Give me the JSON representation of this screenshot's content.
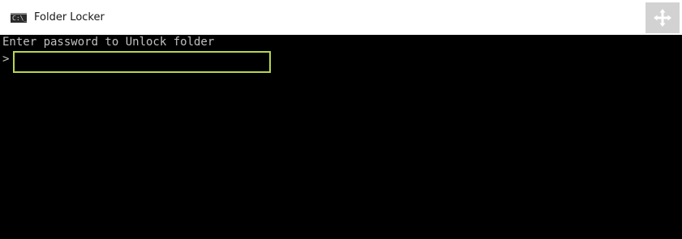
{
  "window": {
    "title": "Folder Locker",
    "icon_name": "command-prompt-icon",
    "icon_glyph": "C:\\_",
    "move_icon_name": "move-arrows-icon"
  },
  "console": {
    "message": "Enter password to Unlock folder",
    "prompt_symbol": ">",
    "password_value": "",
    "background_color": "#000000",
    "text_color": "#c0c0c0",
    "input_highlight_color": "#b8d64a"
  }
}
